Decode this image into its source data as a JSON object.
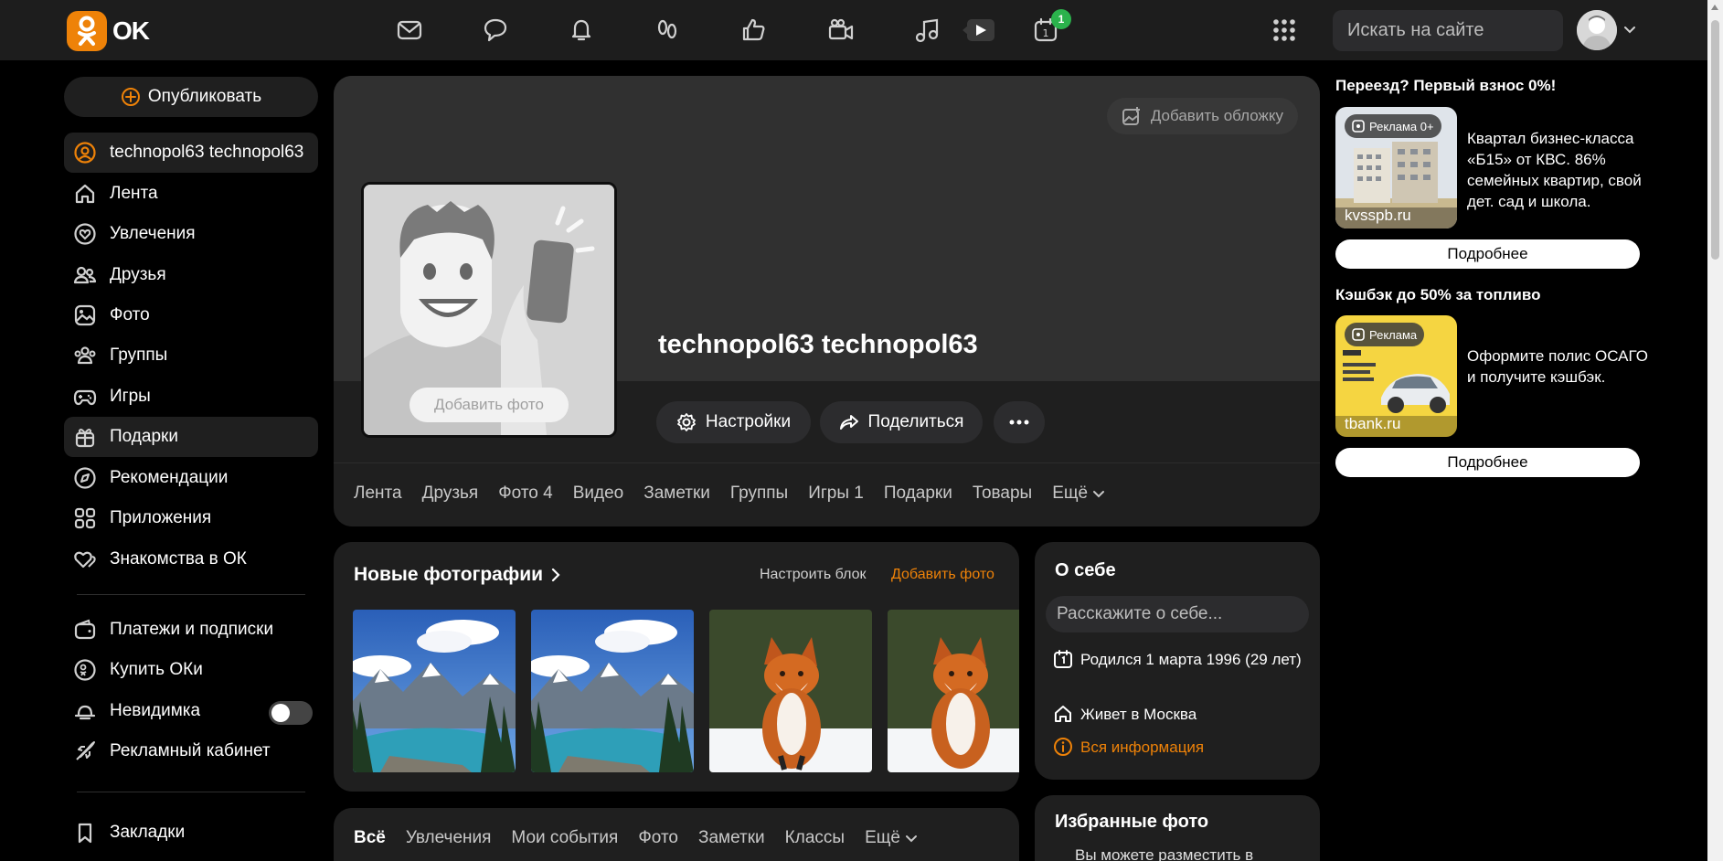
{
  "header": {
    "logo_text": "OK",
    "notification_badge": "1",
    "search_placeholder": "Искать на сайте"
  },
  "sidebar": {
    "publish_label": "Опубликовать",
    "items": [
      {
        "label": "technopol63 technopol63",
        "icon": "user-circle-icon"
      },
      {
        "label": "Лента",
        "icon": "home-icon"
      },
      {
        "label": "Увлечения",
        "icon": "hobby-icon"
      },
      {
        "label": "Друзья",
        "icon": "friends-icon"
      },
      {
        "label": "Фото",
        "icon": "photo-icon"
      },
      {
        "label": "Группы",
        "icon": "groups-icon"
      },
      {
        "label": "Игры",
        "icon": "gamepad-icon"
      },
      {
        "label": "Подарки",
        "icon": "gift-icon"
      },
      {
        "label": "Рекомендации",
        "icon": "compass-icon"
      },
      {
        "label": "Приложения",
        "icon": "apps-icon"
      },
      {
        "label": "Знакомства в ОК",
        "icon": "hearts-icon"
      }
    ],
    "secondary": [
      {
        "label": "Платежи и подписки",
        "icon": "wallet-icon"
      },
      {
        "label": "Купить ОКи",
        "icon": "coin-icon"
      },
      {
        "label": "Невидимка",
        "icon": "invisible-icon"
      },
      {
        "label": "Рекламный кабинет",
        "icon": "rocket-icon"
      }
    ],
    "bookmarks_label": "Закладки"
  },
  "profile": {
    "add_cover_label": "Добавить обложку",
    "add_photo_label": "Добавить фото",
    "name": "technopol63 technopol63",
    "settings_label": "Настройки",
    "share_label": "Поделиться",
    "tabs": [
      "Лента",
      "Друзья",
      "Фото 4",
      "Видео",
      "Заметки",
      "Группы",
      "Игры 1",
      "Подарки",
      "Товары",
      "Ещё"
    ]
  },
  "photos": {
    "title": "Новые фотографии",
    "config_label": "Настроить блок",
    "add_label": "Добавить фото"
  },
  "feed_filters": {
    "tabs": [
      "Всё",
      "Увлечения",
      "Мои события",
      "Фото",
      "Заметки",
      "Классы",
      "Ещё"
    ]
  },
  "about": {
    "title": "О себе",
    "placeholder": "Расскажите о себе...",
    "born": "Родился 1 марта 1996 (29 лет)",
    "lives": "Живет в Москва",
    "all_info": "Вся информация"
  },
  "favorites": {
    "title": "Избранные фото",
    "text": "Вы можете разместить в"
  },
  "ads": [
    {
      "title": "Переезд? Первый взнос 0%!",
      "badge": "Реклама 0+",
      "domain": "kvsspb.ru",
      "text": "Квартал бизнес-класса «Б15» от КВС. 86% семейных квартир, свой дет. сад и школа.",
      "button": "Подробнее"
    },
    {
      "title": "Кэшбэк до 50% за топливо",
      "badge": "Реклама",
      "domain": "tbank.ru",
      "text": "Оформите полис ОСАГО и получите кэшбэк.",
      "button": "Подробнее"
    }
  ],
  "colors": {
    "accent": "#ee8208",
    "badge_green": "#2bb24c",
    "card_bg": "#1f1f1f"
  }
}
